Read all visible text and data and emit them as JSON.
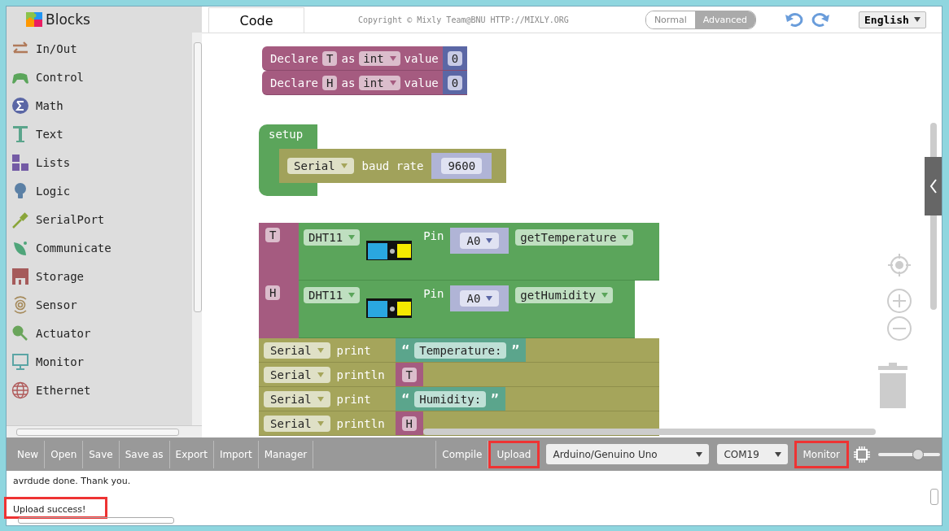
{
  "sidebar": {
    "title": "Blocks",
    "categories": [
      {
        "label": "In/Out",
        "color": "#b07a5a"
      },
      {
        "label": "Control",
        "color": "#5ba55b"
      },
      {
        "label": "Math",
        "color": "#5b67a5"
      },
      {
        "label": "Text",
        "color": "#5ba58c"
      },
      {
        "label": "Lists",
        "color": "#745ba5"
      },
      {
        "label": "Logic",
        "color": "#5b80a5"
      },
      {
        "label": "SerialPort",
        "color": "#8aa53a"
      },
      {
        "label": "Communicate",
        "color": "#4fa57a"
      },
      {
        "label": "Storage",
        "color": "#a55b5b"
      },
      {
        "label": "Sensor",
        "color": "#a58a5b"
      },
      {
        "label": "Actuator",
        "color": "#6aa55b"
      },
      {
        "label": "Monitor",
        "color": "#5ba5a5"
      },
      {
        "label": "Ethernet",
        "color": "#b05a5a"
      }
    ]
  },
  "header": {
    "tab": "Code",
    "copyright": "Copyright © Mixly Team@BNU HTTP://MIXLY.ORG",
    "modes": [
      {
        "label": "Normal",
        "selected": false
      },
      {
        "label": "Advanced",
        "selected": true
      }
    ],
    "language": "English"
  },
  "workspace": {
    "declarations": [
      {
        "keyword": "Declare",
        "var": "T",
        "as": "as",
        "type": "int",
        "value_label": "value",
        "value": "0"
      },
      {
        "keyword": "Declare",
        "var": "H",
        "as": "as",
        "type": "int",
        "value_label": "value",
        "value": "0"
      }
    ],
    "setup": {
      "label": "setup",
      "port": "Serial",
      "baud_label": "baud rate",
      "baud": "9600"
    },
    "reads": [
      {
        "var": "T",
        "sensor": "DHT11",
        "pin_label": "Pin",
        "pin": "A0",
        "method": "getTemperature"
      },
      {
        "var": "H",
        "sensor": "DHT11",
        "pin_label": "Pin",
        "pin": "A0",
        "method": "getHumidity"
      }
    ],
    "prints": [
      {
        "port": "Serial",
        "method": "print",
        "kind": "text",
        "open_quote": "“",
        "value": "Temperature:",
        "close_quote": "”"
      },
      {
        "port": "Serial",
        "method": "println",
        "kind": "var",
        "value": "T"
      },
      {
        "port": "Serial",
        "method": "print",
        "kind": "text",
        "open_quote": "“",
        "value": "Humidity:",
        "close_quote": "”"
      },
      {
        "port": "Serial",
        "method": "println",
        "kind": "var",
        "value": "H"
      }
    ]
  },
  "toolbar": {
    "buttons": [
      {
        "label": "New",
        "highlighted": false
      },
      {
        "label": "Open",
        "highlighted": false
      },
      {
        "label": "Save",
        "highlighted": false
      },
      {
        "label": "Save as",
        "highlighted": false
      },
      {
        "label": "Export",
        "highlighted": false
      },
      {
        "label": "Import",
        "highlighted": false
      },
      {
        "label": "Manager",
        "highlighted": false
      }
    ],
    "actions": [
      {
        "label": "Compile",
        "highlighted": false
      },
      {
        "label": "Upload",
        "highlighted": true
      }
    ],
    "board": "Arduino/Genuino Uno",
    "port": "COM19",
    "monitor": {
      "label": "Monitor",
      "highlighted": true
    },
    "zoom": {
      "level": 0.65
    }
  },
  "console": {
    "lines": [
      {
        "text": "avrdude done.  Thank you.",
        "highlighted": false
      },
      {
        "text": "Upload success!",
        "highlighted": true
      }
    ]
  }
}
